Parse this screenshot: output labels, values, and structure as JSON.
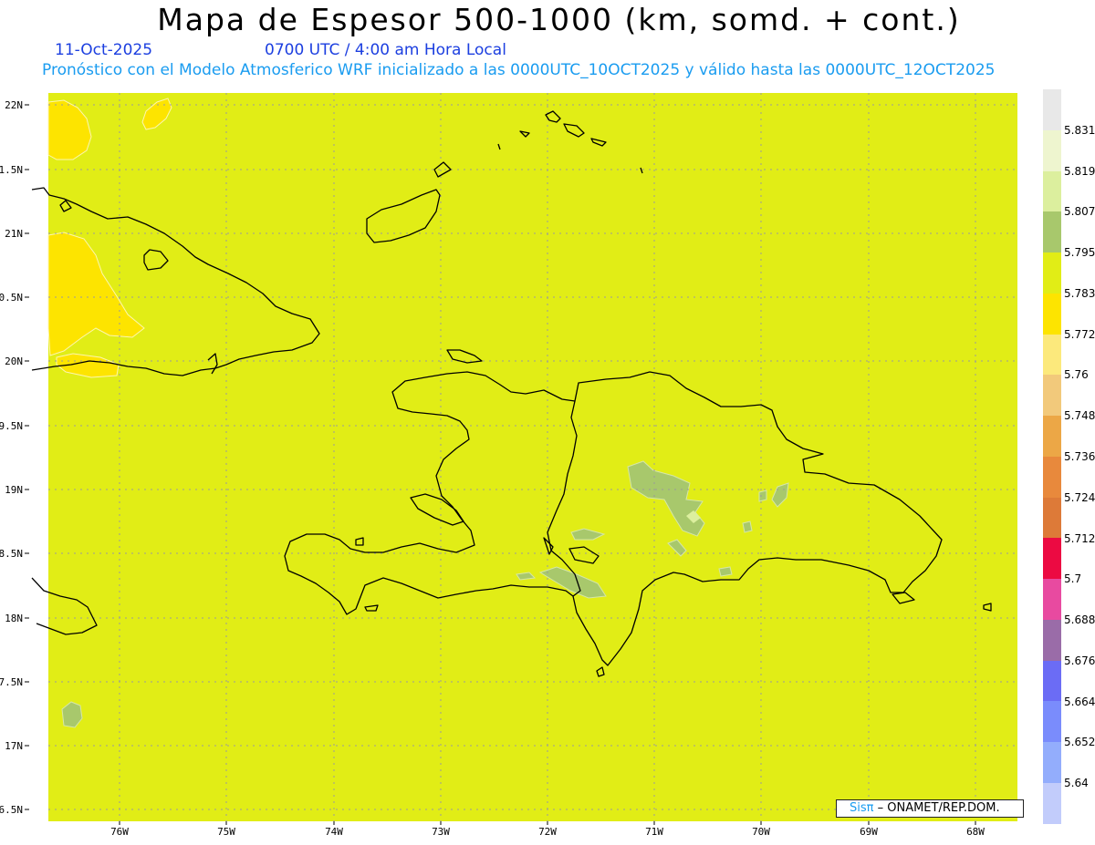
{
  "header": {
    "title": "Mapa de Espesor 500-1000 (km, somd. + cont.)",
    "date": "11-Oct-2025",
    "time": "0700 UTC / 4:00 am Hora Local",
    "description": "Pronóstico con el Modelo Atmosferico WRF inicializado a las 0000UTC_10OCT2025 y válido hasta las  0000UTC_12OCT2025"
  },
  "axes": {
    "lat_labels": [
      "22N",
      "1.5N",
      "21N",
      "0.5N",
      "20N",
      "9.5N",
      "19N",
      "8.5N",
      "18N",
      "7.5N",
      "17N",
      "6.5N"
    ],
    "lon_labels": [
      "76W",
      "75W",
      "74W",
      "73W",
      "72W",
      "71W",
      "70W",
      "69W",
      "68W"
    ]
  },
  "colorbar": {
    "labels": [
      "5.831",
      "5.819",
      "5.807",
      "5.795",
      "5.783",
      "5.772",
      "5.76",
      "5.748",
      "5.736",
      "5.724",
      "5.712",
      "5.7",
      "5.688",
      "5.676",
      "5.664",
      "5.652",
      "5.64"
    ],
    "colors": [
      "#e8e8e8",
      "#eef5cf",
      "#dcef9e",
      "#a8c86c",
      "#e1ed16",
      "#fde400",
      "#fce97c",
      "#f2c97b",
      "#eca746",
      "#e8893c",
      "#dd7a38",
      "#ec0a42",
      "#e84aa0",
      "#9a6ca8",
      "#6b6cf5",
      "#7a8cfc",
      "#93adfc",
      "#c2ccfb"
    ]
  },
  "credit": {
    "brand": "Sisπ",
    "org": "– ONAMET/REP.DOM."
  },
  "colors": {
    "field": "#e1ed16",
    "warm": "#fde400",
    "cool": "#a8c86c",
    "coast": "#000000"
  }
}
